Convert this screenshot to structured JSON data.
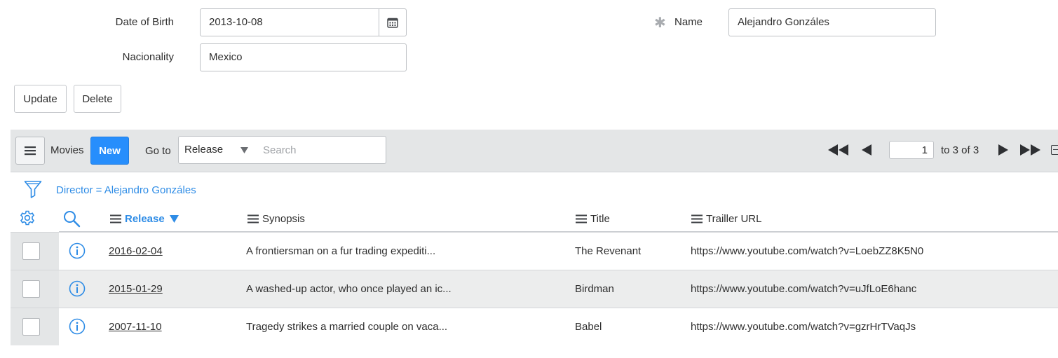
{
  "form": {
    "dob_label": "Date of Birth",
    "dob_value": "2013-10-08",
    "nationality_label": "Nacionality",
    "nationality_value": "Mexico",
    "name_required_mark": "✱",
    "name_label": "Name",
    "name_value": "Alejandro Gonzáles",
    "update_label": "Update",
    "delete_label": "Delete"
  },
  "list": {
    "title": "Movies",
    "new_label": "New",
    "goto_label": "Go to",
    "goto_field": "Release",
    "search_placeholder": "Search",
    "page_value": "1",
    "page_range": "to 3 of 3",
    "filter_text": "Director = Alejandro Gonzáles",
    "columns": {
      "release": "Release",
      "synopsis": "Synopsis",
      "title": "Title",
      "trailer": "Trailler URL"
    },
    "rows": [
      {
        "release": "2016-02-04",
        "synopsis": "A frontiersman on a fur trading expediti...",
        "title": "The Revenant",
        "trailer": "https://www.youtube.com/watch?v=LoebZZ8K5N0"
      },
      {
        "release": "2015-01-29",
        "synopsis": "A washed-up actor, who once played an ic...",
        "title": "Birdman",
        "trailer": "https://www.youtube.com/watch?v=uJfLoE6hanc"
      },
      {
        "release": "2007-11-10",
        "synopsis": "Tragedy strikes a married couple on vaca...",
        "title": "Babel",
        "trailer": "https://www.youtube.com/watch?v=gzrHrTVaqJs"
      }
    ]
  },
  "colors": {
    "accent_blue": "#278efc",
    "link_blue": "#2e8ce6",
    "bar_gray": "#e4e6e7"
  },
  "icons": {
    "calendar": "calendar-icon",
    "hamburger": "hamburger-menu-icon",
    "filter": "filter-icon",
    "gear": "gear-icon",
    "search": "search-icon",
    "info": "info-icon",
    "sort": "sort-descending-icon"
  }
}
